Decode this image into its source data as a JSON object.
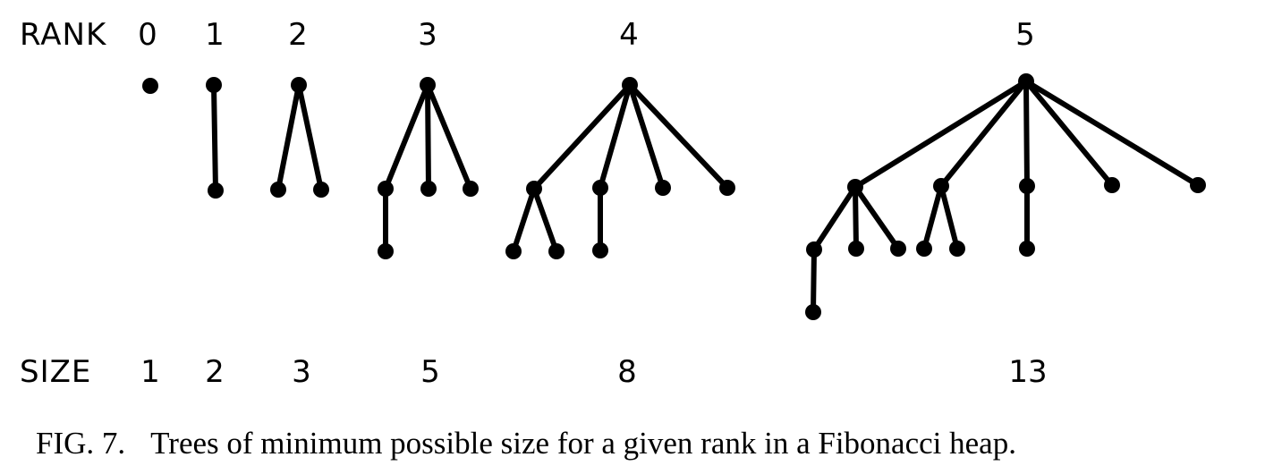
{
  "rank_label": "RANK",
  "size_label": "SIZE",
  "trees": [
    {
      "rank": "0",
      "size": "1"
    },
    {
      "rank": "1",
      "size": "2"
    },
    {
      "rank": "2",
      "size": "3"
    },
    {
      "rank": "3",
      "size": "5"
    },
    {
      "rank": "4",
      "size": "8"
    },
    {
      "rank": "5",
      "size": "13"
    }
  ],
  "caption": {
    "prefix": "FIG. 7.",
    "text": "Trees of minimum possible size for a given rank in a Fibonacci heap."
  }
}
